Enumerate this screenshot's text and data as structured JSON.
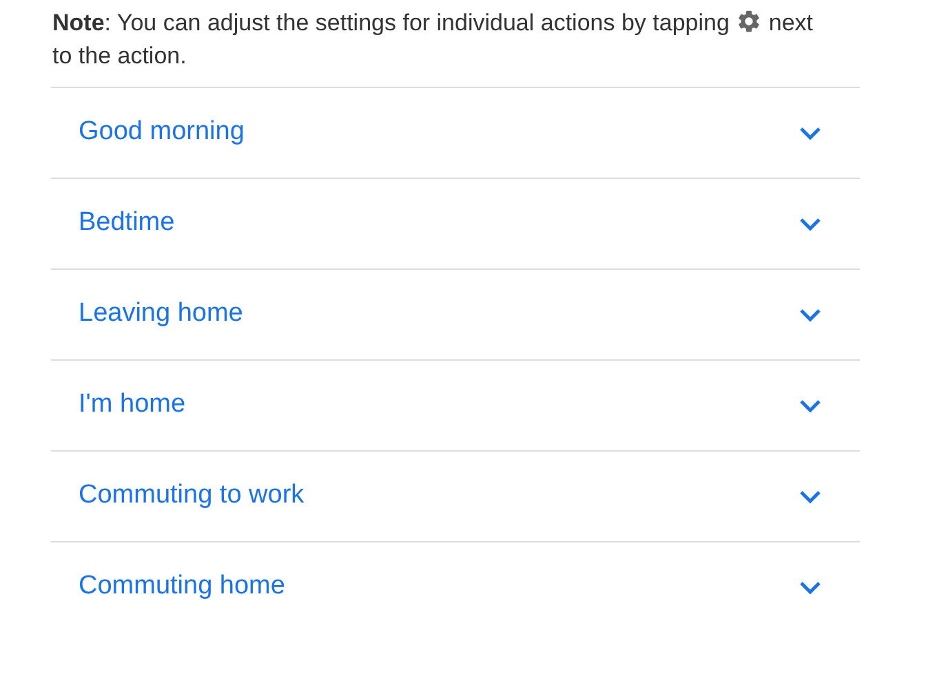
{
  "note": {
    "before": "**Note**: You can adjust the settings for individual actions by tapping",
    "after": "next",
    "line_2": "to the action."
  },
  "actions": [
    {
      "label": "Good morning",
      "expanded": false
    },
    {
      "label": "Bedtime",
      "expanded": false
    },
    {
      "label": "Leaving home",
      "expanded": false
    },
    {
      "label": "I'm home",
      "expanded": false
    },
    {
      "label": "Commuting to work",
      "expanded": false
    },
    {
      "label": "Commuting home",
      "expanded": false
    }
  ]
}
